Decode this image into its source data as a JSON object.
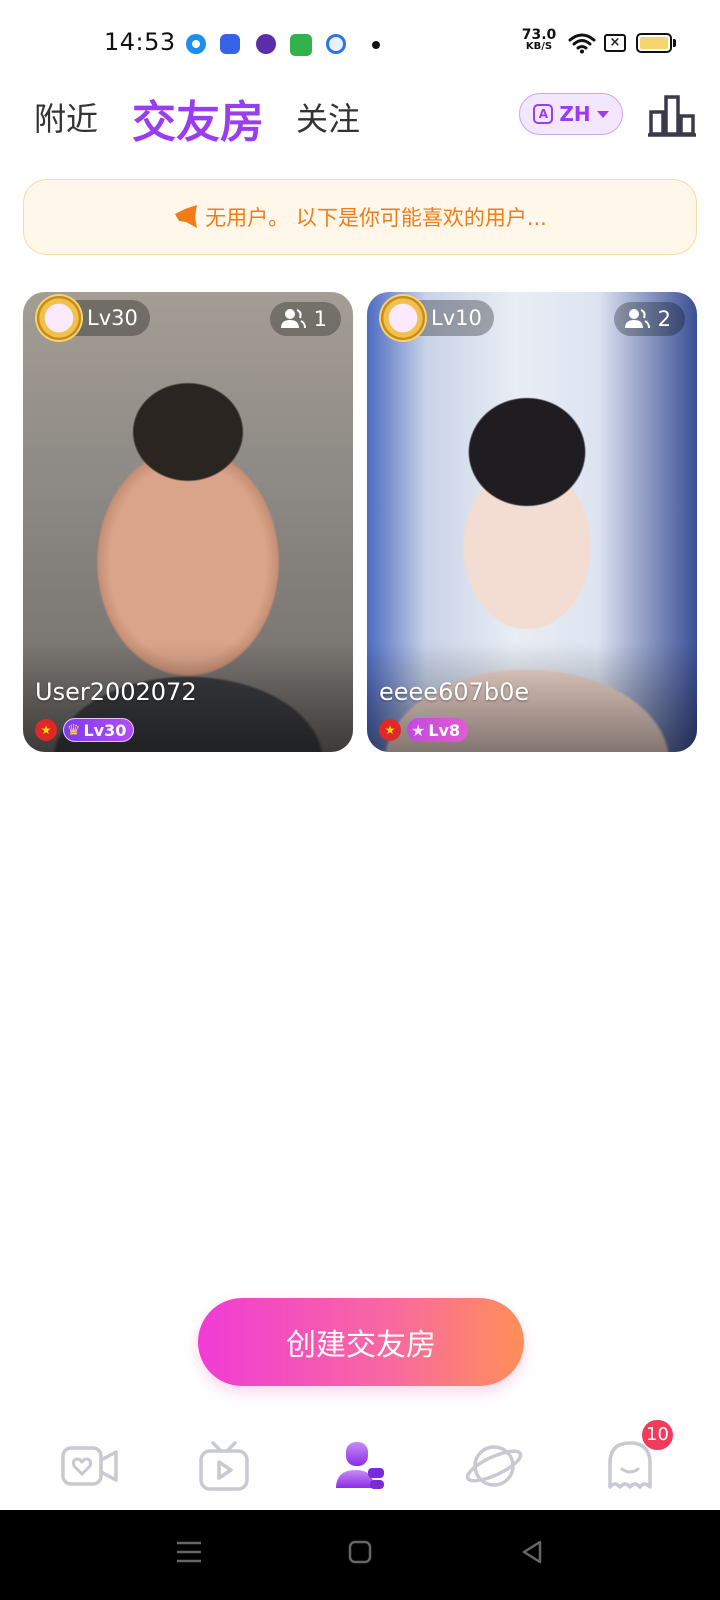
{
  "status_bar": {
    "time": "14:53",
    "net_speed_value": "73.0",
    "net_speed_unit": "KB/S"
  },
  "header": {
    "tabs": [
      {
        "label": "附近",
        "active": false
      },
      {
        "label": "交友房",
        "active": true
      },
      {
        "label": "关注",
        "active": false
      }
    ],
    "language": "ZH"
  },
  "notice": {
    "text": "无用户。 以下是你可能喜欢的用户..."
  },
  "rooms": [
    {
      "host_level": "Lv30",
      "viewers": "1",
      "name": "User2002072",
      "badge_level": "Lv30",
      "badge_icon": "crown-icon"
    },
    {
      "host_level": "Lv10",
      "viewers": "2",
      "name": "eeee607b0e",
      "badge_level": "Lv8",
      "badge_icon": "star-icon"
    }
  ],
  "create_button": {
    "label": "创建交友房"
  },
  "bottom_nav": {
    "items": [
      "video-call-icon",
      "tv-icon",
      "rooms-icon",
      "planet-icon",
      "ghost-icon"
    ],
    "active_index": 2,
    "message_badge": "10"
  },
  "colors": {
    "accent": "#9a3df0",
    "notice_text": "#f07c1a",
    "badge_red": "#f23b5a"
  }
}
